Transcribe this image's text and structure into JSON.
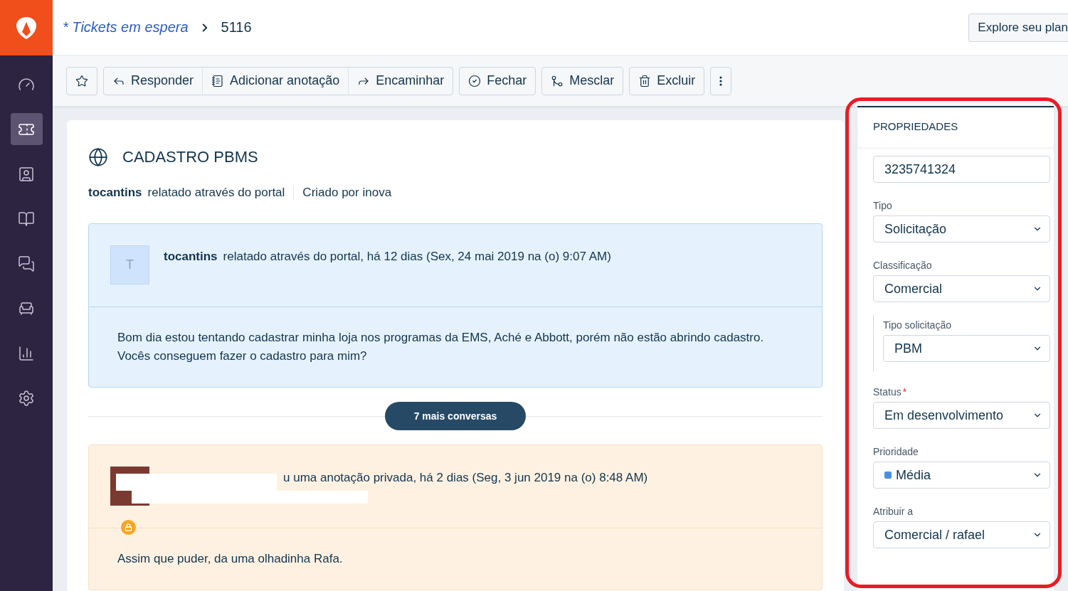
{
  "breadcrumb": {
    "parent": "* Tickets em espera",
    "current": "5116"
  },
  "explore_button": "Explore seu plan",
  "nav": [
    {
      "kind": "dashboard",
      "selected": false
    },
    {
      "kind": "tickets",
      "selected": true
    },
    {
      "kind": "contacts",
      "selected": false
    },
    {
      "kind": "solutions",
      "selected": false
    },
    {
      "kind": "forums",
      "selected": false
    },
    {
      "kind": "admin",
      "selected": false
    },
    {
      "kind": "reports",
      "selected": false
    },
    {
      "kind": "settings",
      "selected": false
    }
  ],
  "toolbar": [
    [
      {
        "kind": "star"
      }
    ],
    [
      {
        "kind": "reply",
        "label": "Responder"
      },
      {
        "kind": "note",
        "label": "Adicionar anotação"
      },
      {
        "kind": "forward",
        "label": "Encaminhar"
      }
    ],
    [
      {
        "kind": "close",
        "label": "Fechar"
      }
    ],
    [
      {
        "kind": "merge",
        "label": "Mesclar"
      }
    ],
    [
      {
        "kind": "delete",
        "label": "Excluir"
      }
    ],
    [
      {
        "kind": "more"
      }
    ]
  ],
  "ticket": {
    "title": "CADASTRO PBMS",
    "requester": "tocantins",
    "via": "relatado através do portal",
    "created_by": "Criado por inova"
  },
  "conversations": [
    {
      "kind": "public",
      "avatar_letter": "T",
      "author": "tocantins",
      "meta": "relatado através do portal, há 12 dias (Sex, 24 mai 2019 na (o) 9:07 AM)",
      "body": "Bom dia estou tentando cadastrar minha loja nos programas da EMS, Aché e Abbott, porém não estão abrindo cadastro.\nVocês conseguem fazer o cadastro para mim?"
    },
    {
      "kind": "private",
      "meta": "u uma anotação privada, há 2 dias (Seg, 3 jun 2019 na (o) 8:48 AM)",
      "body": "Assim que puder, da uma olhadinha Rafa."
    }
  ],
  "more_button": "7 mais conversas",
  "properties": {
    "title": "PROPRIEDADES",
    "fields": [
      {
        "kind": "input",
        "value": "3235741324"
      },
      {
        "kind": "select",
        "label": "Tipo",
        "value": "Solicitação"
      },
      {
        "kind": "select",
        "label": "Classificação",
        "value": "Comercial"
      },
      {
        "kind": "nested",
        "label": "Tipo solicitação",
        "value": "PBM"
      },
      {
        "kind": "select",
        "label": "Status",
        "required_mark": "*",
        "value": "Em desenvolvimento"
      },
      {
        "kind": "select",
        "label": "Prioridade",
        "value": "Média",
        "color": "#4a90e2"
      },
      {
        "kind": "select",
        "label": "Atribuir a",
        "value": "Comercial / rafael"
      }
    ]
  }
}
